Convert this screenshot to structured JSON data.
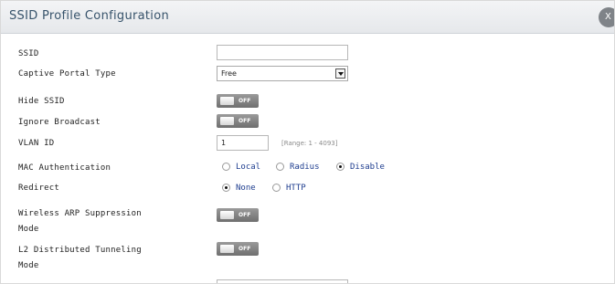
{
  "dialog": {
    "title": "SSID Profile Configuration",
    "close_label": "X"
  },
  "ssid": {
    "label": "SSID",
    "value": ""
  },
  "captive_portal": {
    "label": "Captive Portal Type",
    "selected": "Free"
  },
  "hide_ssid": {
    "label": "Hide SSID",
    "state": "OFF"
  },
  "ignore_broadcast": {
    "label": "Ignore Broadcast",
    "state": "OFF"
  },
  "vlan_id": {
    "label": "VLAN ID",
    "value": "1",
    "hint": "[Range: 1 - 4093]"
  },
  "mac_auth": {
    "label": "MAC Authentication",
    "options": [
      "Local",
      "Radius",
      "Disable"
    ],
    "selected": "Disable"
  },
  "redirect": {
    "label": "Redirect",
    "options": [
      "None",
      "HTTP"
    ],
    "selected": "None"
  },
  "wireless_arp": {
    "label_line1": "Wireless ARP Suppression",
    "label_line2": "Mode",
    "state": "OFF"
  },
  "l2_tunneling": {
    "label_line1": "L2 Distributed Tunneling",
    "label_line2": "Mode",
    "state": "OFF"
  },
  "colors": {
    "title_text": "#37536b",
    "radio_label": "#1e3d8f",
    "toggle_off": "#7f7f7f"
  },
  "icons": {
    "close": "close-icon",
    "dropdown": "chevron-down-icon"
  }
}
